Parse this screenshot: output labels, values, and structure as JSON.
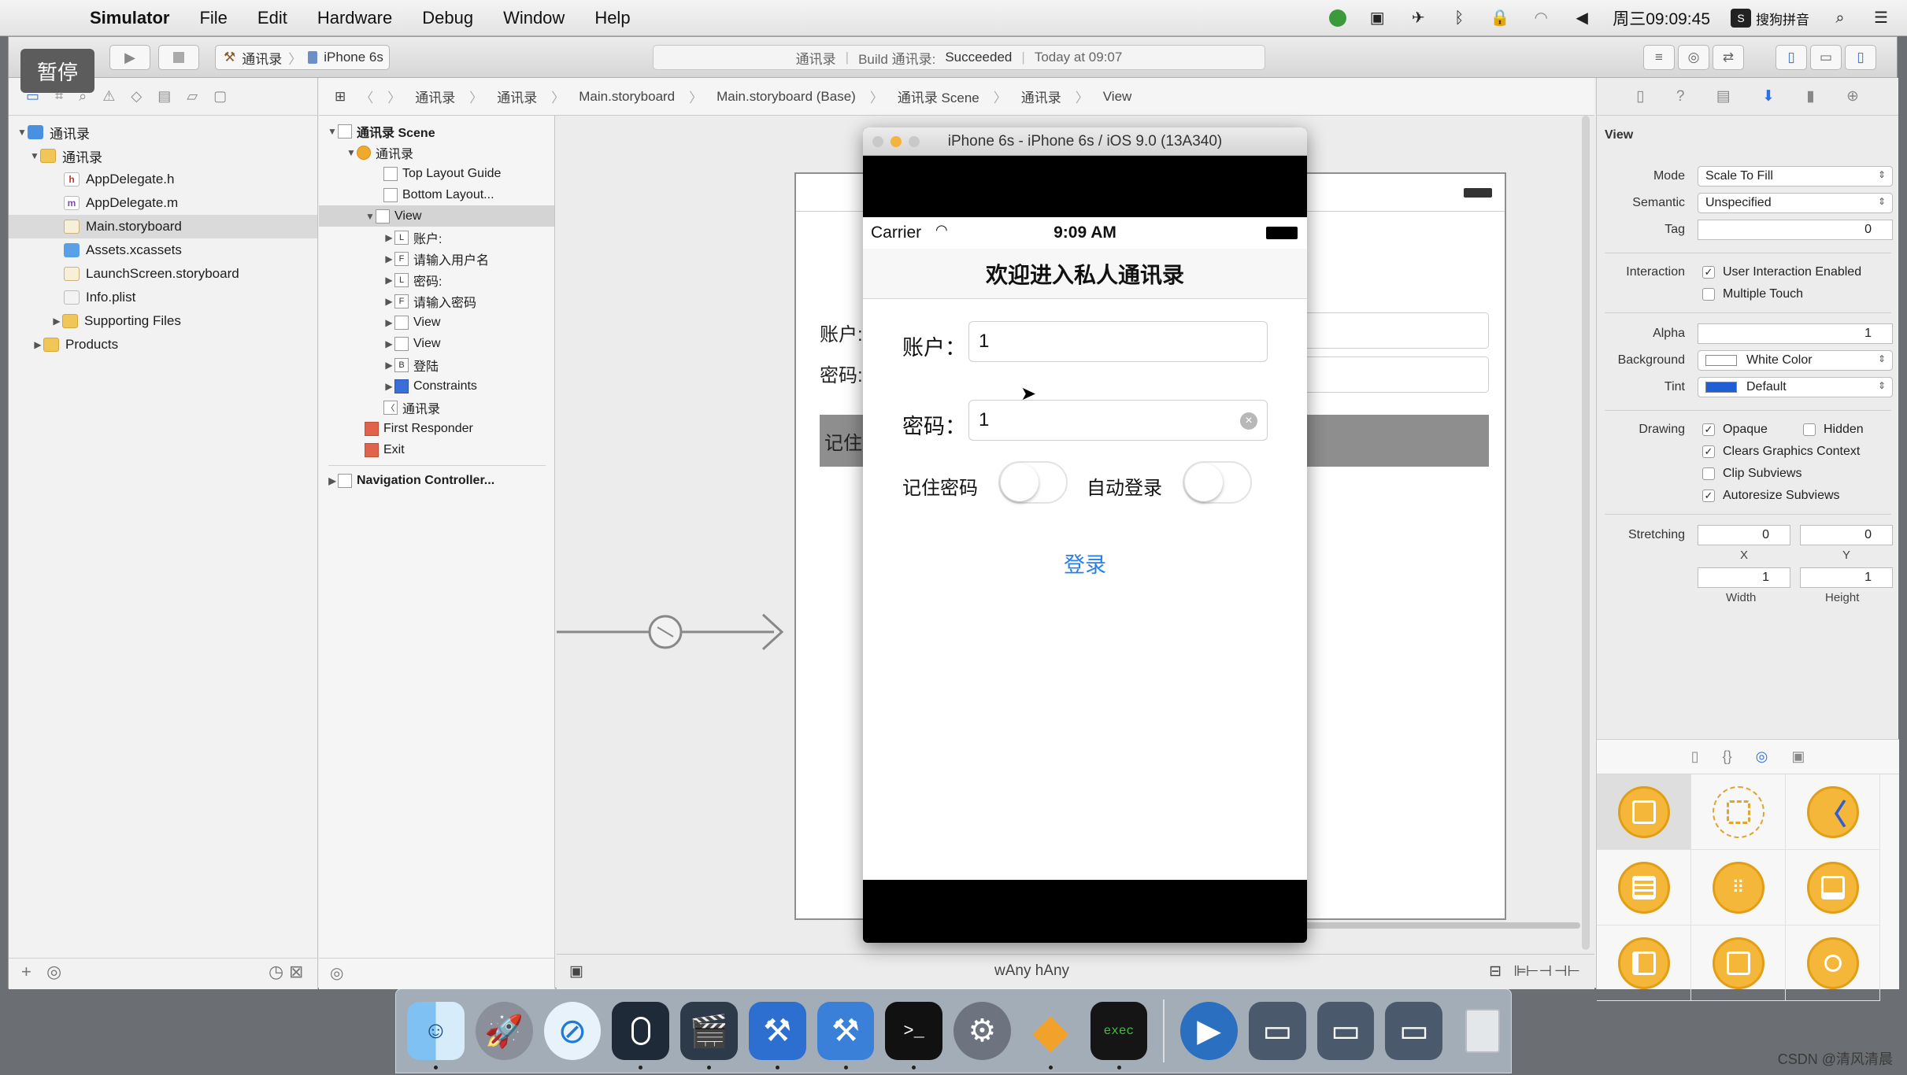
{
  "menubar": {
    "app": "Simulator",
    "items": [
      "File",
      "Edit",
      "Hardware",
      "Debug",
      "Window",
      "Help"
    ],
    "clock": "周三09:09:45",
    "ime": "搜狗拼音"
  },
  "overlay": {
    "pause": "暂停"
  },
  "toolbar": {
    "scheme_target": "通讯录",
    "scheme_device": "iPhone 6s",
    "activity_project": "通讯录",
    "activity_build_prefix": "Build 通讯录:",
    "activity_status": "Succeeded",
    "activity_time": "Today at 09:07"
  },
  "jumpbar": [
    "通讯录",
    "通讯录",
    "Main.storyboard",
    "Main.storyboard (Base)",
    "通讯录 Scene",
    "通讯录",
    "View"
  ],
  "navigator": {
    "items": [
      {
        "label": "通讯录",
        "icon": "project-icon"
      },
      {
        "label": "通讯录",
        "icon": "folder-icon"
      },
      {
        "label": "AppDelegate.h",
        "icon": "h-file-icon"
      },
      {
        "label": "AppDelegate.m",
        "icon": "m-file-icon"
      },
      {
        "label": "Main.storyboard",
        "icon": "storyboard-icon"
      },
      {
        "label": "Assets.xcassets",
        "icon": "assets-icon"
      },
      {
        "label": "LaunchScreen.storyboard",
        "icon": "storyboard-icon"
      },
      {
        "label": "Info.plist",
        "icon": "plist-icon"
      },
      {
        "label": "Supporting Files",
        "icon": "folder-icon"
      },
      {
        "label": "Products",
        "icon": "folder-icon"
      }
    ]
  },
  "outline": {
    "items": [
      "通讯录 Scene",
      "通讯录",
      "Top Layout Guide",
      "Bottom Layout...",
      "View",
      "账户:",
      "请输入用户名",
      "密码:",
      "请输入密码",
      "View",
      "View",
      "登陆",
      "Constraints",
      "通讯录",
      "First Responder",
      "Exit",
      "Navigation Controller..."
    ],
    "badges": [
      "L",
      "F",
      "L",
      "F",
      "B"
    ]
  },
  "storyboard": {
    "account_label": "账户:",
    "password_label": "密码:",
    "gray_label": "记住"
  },
  "simulator": {
    "title": "iPhone 6s - iPhone 6s / iOS 9.0 (13A340)",
    "carrier": "Carrier",
    "time": "9:09 AM",
    "nav_title": "欢迎进入私人通讯录",
    "account_label": "账户：",
    "account_value": "1",
    "password_label": "密码：",
    "password_value": "1",
    "remember_label": "记住密码",
    "autologin_label": "自动登录",
    "login_button": "登录"
  },
  "canvas_bottom": {
    "size_class": "wAny hAny"
  },
  "inspector": {
    "section": "View",
    "mode_label": "Mode",
    "mode_value": "Scale To Fill",
    "semantic_label": "Semantic",
    "semantic_value": "Unspecified",
    "tag_label": "Tag",
    "tag_value": "0",
    "interaction_label": "Interaction",
    "user_interaction": "User Interaction Enabled",
    "multiple_touch": "Multiple Touch",
    "alpha_label": "Alpha",
    "alpha_value": "1",
    "background_label": "Background",
    "background_value": "White Color",
    "tint_label": "Tint",
    "tint_value": "Default",
    "drawing_label": "Drawing",
    "opaque": "Opaque",
    "hidden": "Hidden",
    "clears": "Clears Graphics Context",
    "clip": "Clip Subviews",
    "autoresize": "Autoresize Subviews",
    "stretching_label": "Stretching",
    "stretch_x": "0",
    "stretch_y": "0",
    "stretch_w": "1",
    "stretch_h": "1",
    "x_label": "X",
    "y_label": "Y",
    "width_label": "Width",
    "height_label": "Height"
  },
  "watermark": "CSDN @清风清晨",
  "colors": {
    "accent_blue": "#2a7fe6",
    "tint_swatch": "#1f5fd6",
    "library_orange": "#f4b73a"
  }
}
